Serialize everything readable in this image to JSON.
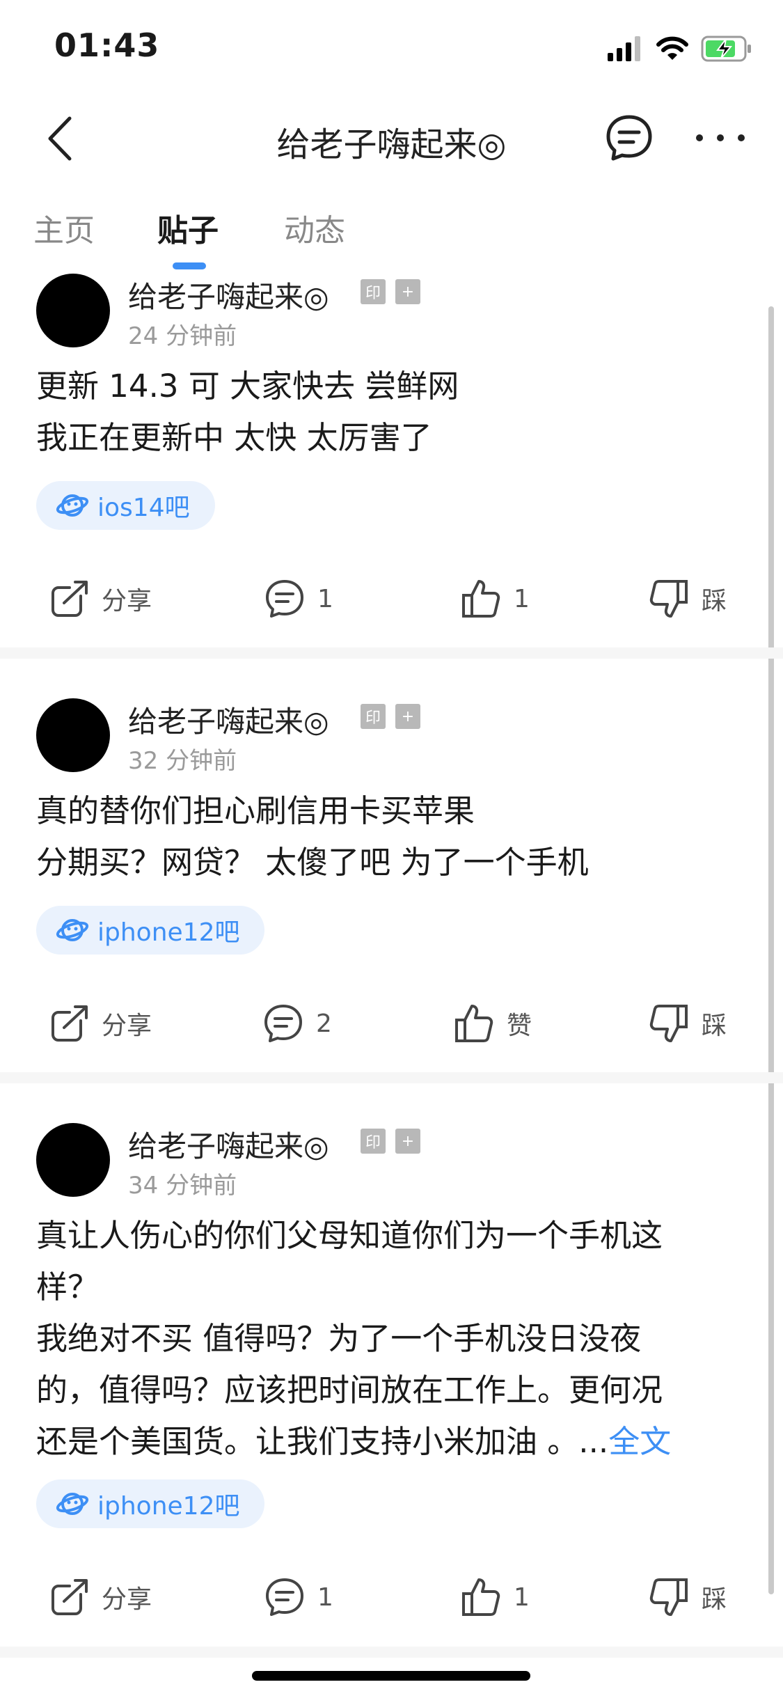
{
  "status_bar": {
    "time": "01:43"
  },
  "nav": {
    "title": "给老子嗨起来◎"
  },
  "tabs": [
    {
      "label": "主页",
      "active": false
    },
    {
      "label": "贴子",
      "active": true
    },
    {
      "label": "动态",
      "active": false
    }
  ],
  "badges": {
    "seal": "印",
    "plus": "+"
  },
  "posts": [
    {
      "username": "给老子嗨起来◎",
      "time_ago": "24 分钟前",
      "lines": [
        "更新 14.3 可 大家快去 尝鲜网",
        "我正在更新中 太快 太厉害了"
      ],
      "forum": "ios14吧",
      "actions": {
        "share": "分享",
        "comment": "1",
        "like": "1",
        "dislike": "踩"
      }
    },
    {
      "username": "给老子嗨起来◎",
      "time_ago": "32 分钟前",
      "lines": [
        "真的替你们担心刷信用卡买苹果",
        "分期买？网贷？  太傻了吧 为了一个手机"
      ],
      "forum": "iphone12吧",
      "actions": {
        "share": "分享",
        "comment": "2",
        "like": "赞",
        "dislike": "踩"
      }
    },
    {
      "username": "给老子嗨起来◎",
      "time_ago": "34 分钟前",
      "lines": [
        "真让人伤心的你们父母知道你们为一个手机这",
        "样？",
        "我绝对不买 值得吗？为了一个手机没日没夜",
        "的，值得吗？应该把时间放在工作上。更何况",
        "还是个美国货。让我们支持小米加油 。..."
      ],
      "full_text_link": "全文",
      "forum": "iphone12吧",
      "actions": {
        "share": "分享",
        "comment": "1",
        "like": "1",
        "dislike": "踩"
      }
    }
  ]
}
